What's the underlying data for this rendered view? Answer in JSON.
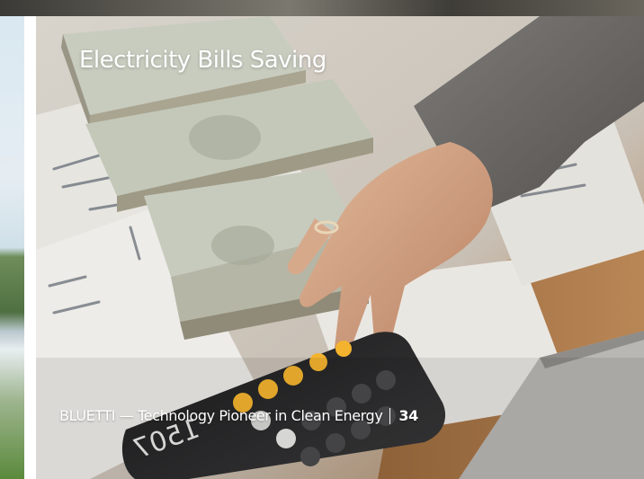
{
  "slide": {
    "title": "Electricity Bills Saving",
    "footer_text": "BLUETTI — Technology Pioneer in Clean Energy",
    "page_number": "34"
  },
  "image": {
    "description_icon": "calculator-money-photo"
  }
}
